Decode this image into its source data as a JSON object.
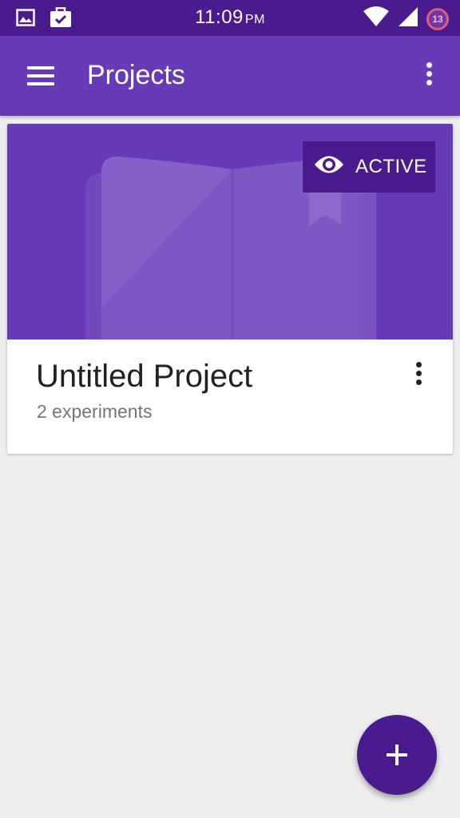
{
  "status_bar": {
    "time": "11:09",
    "ampm": "PM",
    "notification_count": "13",
    "icons": [
      "image-icon",
      "task-icon",
      "wifi-icon",
      "signal-icon",
      "notification-badge"
    ]
  },
  "app_bar": {
    "title": "Projects",
    "menu_icon": "hamburger-menu-icon",
    "overflow_icon": "more-vert-icon"
  },
  "project_card": {
    "title": "Untitled Project",
    "subtitle": "2 experiments",
    "badge_label": "ACTIVE",
    "badge_icon": "eye-icon",
    "hero_icon": "notebook-illustration",
    "more_icon": "more-vert-icon"
  },
  "fab": {
    "icon": "add-icon"
  },
  "colors": {
    "status_bar": "#4a1a8f",
    "primary": "#673ab7",
    "primary_dark": "#4a1a8f",
    "background": "#eeeeee",
    "card": "#ffffff"
  }
}
